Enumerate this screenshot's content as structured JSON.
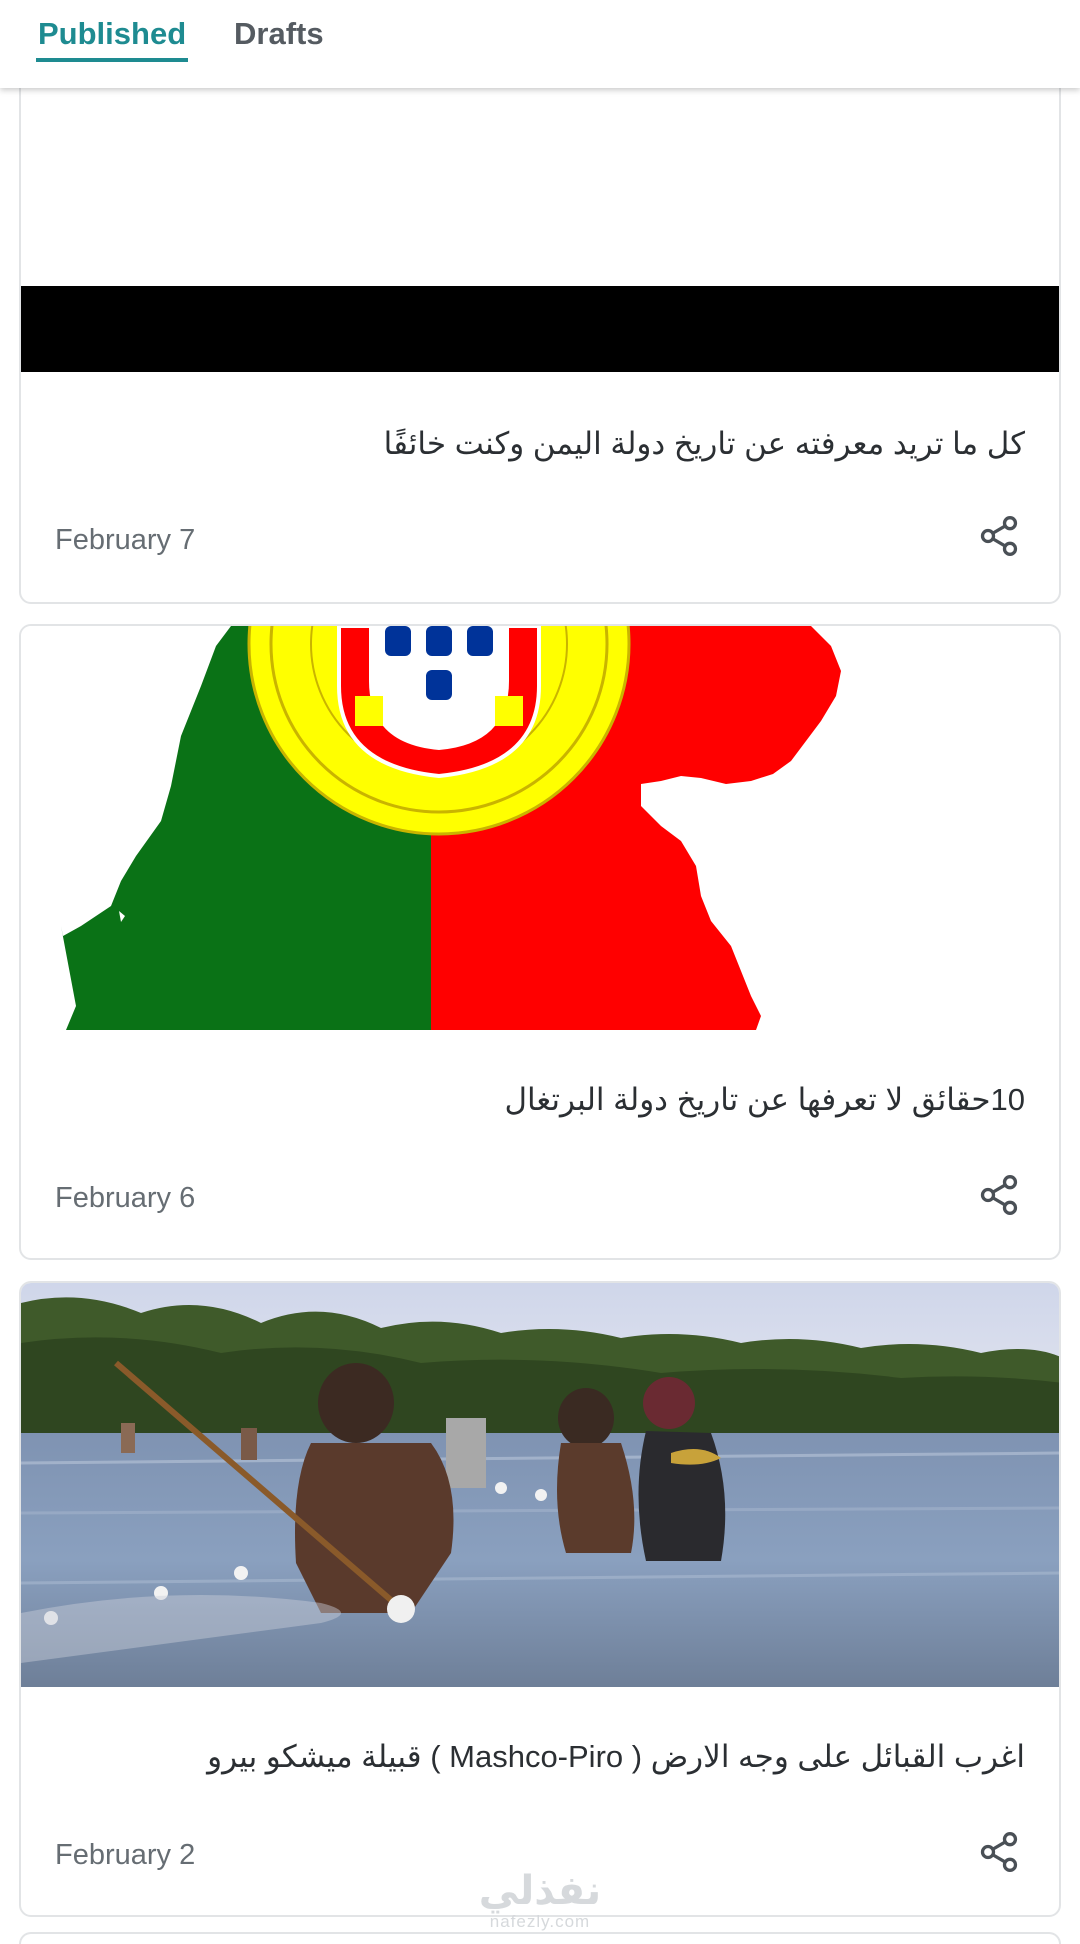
{
  "tabs": {
    "published_label": "Published",
    "drafts_label": "Drafts",
    "active_color": "#1e8b91"
  },
  "posts": [
    {
      "title": "كل ما تريد معرفته عن تاريخ دولة اليمن وكنت خائفًا",
      "date": "February 7",
      "image": "yemen-flag-image",
      "share_icon": "share-icon"
    },
    {
      "title": "10حقائق لا تعرفها عن تاريخ دولة البرتغال",
      "date": "February 6",
      "image": "portugal-flag-map-image",
      "share_icon": "share-icon"
    },
    {
      "title": "اغرب القبائل على وجه الارض ( Mashco-Piro ) قبيلة ميشكو بيرو",
      "date": "February 2",
      "image": "river-fishing-photo",
      "share_icon": "share-icon"
    }
  ],
  "watermark": {
    "arabic": "نفذلي",
    "latin": "nafezly.com"
  }
}
